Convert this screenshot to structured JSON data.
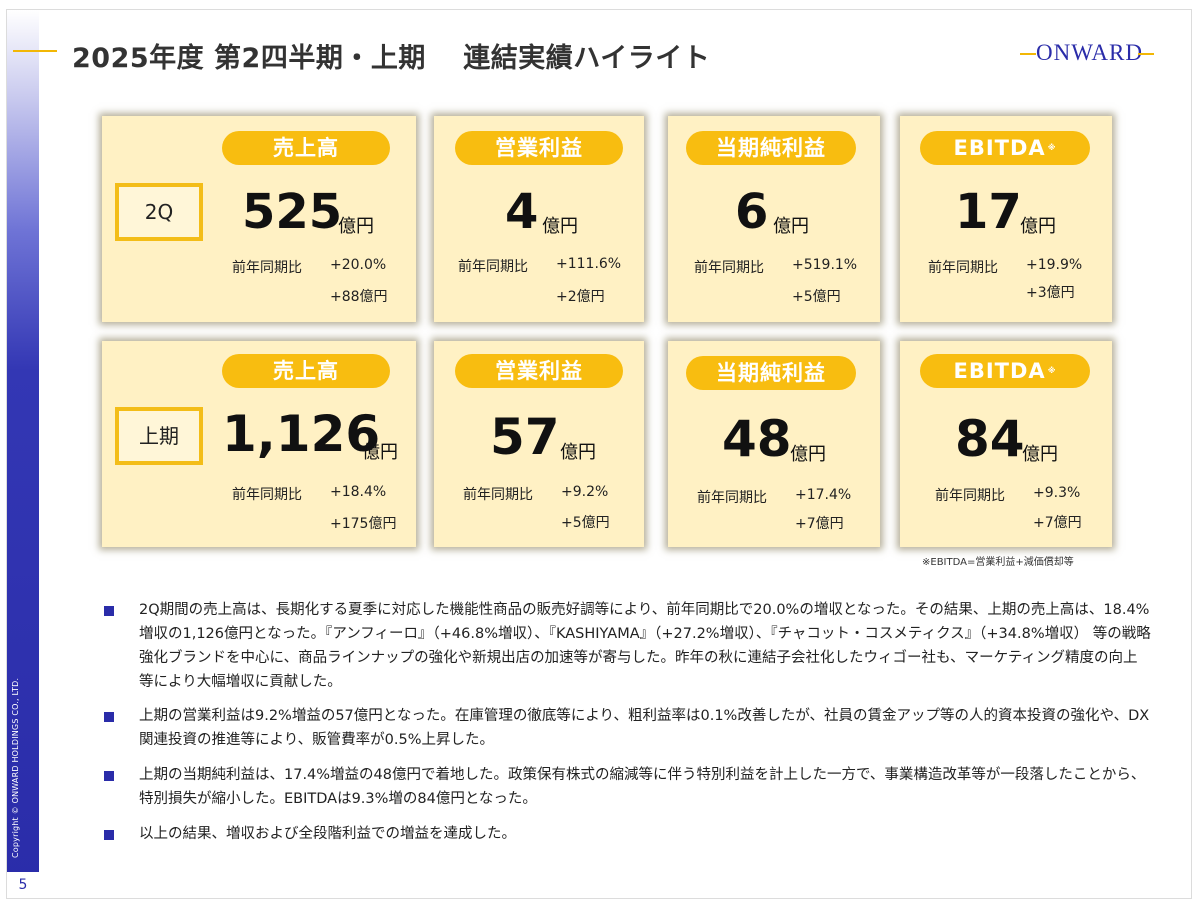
{
  "slide": {
    "title": "2025年度 第2四半期・上期　 連結実績ハイライト",
    "logo": "ONWARD",
    "copyright": "Copyright © ONWARD HOLDINGS CO., LTD.",
    "page_number": "5",
    "note": "※EBITDA=営業利益+減価償却等"
  },
  "rows": [
    {
      "period": "2Q",
      "cards": [
        {
          "label": "売上高",
          "value": "525",
          "unit": "億円",
          "yoy_label": "前年同期比",
          "yoy_pct": "+20.0%",
          "yoy_amount": "+88億円"
        },
        {
          "label": "営業利益",
          "value": "4",
          "unit": "億円",
          "yoy_label": "前年同期比",
          "yoy_pct": "+111.6%",
          "yoy_amount": "+2億円"
        },
        {
          "label": "当期純利益",
          "value": "6",
          "unit": "億円",
          "yoy_label": "前年同期比",
          "yoy_pct": "+519.1%",
          "yoy_amount": "+5億円"
        },
        {
          "label": "EBITDA",
          "label_mark": "※",
          "value": "17",
          "unit": "億円",
          "yoy_label": "前年同期比",
          "yoy_pct": "+19.9%",
          "yoy_amount": "+3億円"
        }
      ]
    },
    {
      "period": "上期",
      "cards": [
        {
          "label": "売上高",
          "value": "1,126",
          "unit": "億円",
          "yoy_label": "前年同期比",
          "yoy_pct": "+18.4%",
          "yoy_amount": "+175億円"
        },
        {
          "label": "営業利益",
          "value": "57",
          "unit": "億円",
          "yoy_label": "前年同期比",
          "yoy_pct": "+9.2%",
          "yoy_amount": "+5億円"
        },
        {
          "label": "当期純利益",
          "value": "48",
          "unit": "億円",
          "yoy_label": "前年同期比",
          "yoy_pct": "+17.4%",
          "yoy_amount": "+7億円"
        },
        {
          "label": "EBITDA",
          "label_mark": "※",
          "value": "84",
          "unit": "億円",
          "yoy_label": "前年同期比",
          "yoy_pct": "+9.3%",
          "yoy_amount": "+7億円"
        }
      ]
    }
  ],
  "bullets": [
    "2Q期間の売上高は、長期化する夏季に対応した機能性商品の販売好調等により、前年同期比で20.0%の増収となった。その結果、上期の売上高は、18.4%増収の1,126億円となった。『アンフィーロ』（+46.8%増収）、『KASHIYAMA』（+27.2%増収）、『チャコット・コスメティクス』（+34.8%増収） 等の戦略強化ブランドを中心に、商品ラインナップの強化や新規出店の加速等が寄与した。昨年の秋に連結子会社化したウィゴー社も、マーケティング精度の向上等により大幅増収に貢献した。",
    "上期の営業利益は9.2%増益の57億円となった。在庫管理の徹底等により、粗利益率は0.1%改善したが、社員の賃金アップ等の人的資本投資の強化や、DX関連投資の推進等により、販管費率が0.5%上昇した。",
    "上期の当期純利益は、17.4%増益の48億円で着地した。政策保有株式の縮減等に伴う特別利益を計上した一方で、事業構造改革等が一段落したことから、特別損失が縮小した。EBITDAは9.3%増の84億円となった。",
    "以上の結果、増収および全段階利益での増益を達成した。"
  ]
}
